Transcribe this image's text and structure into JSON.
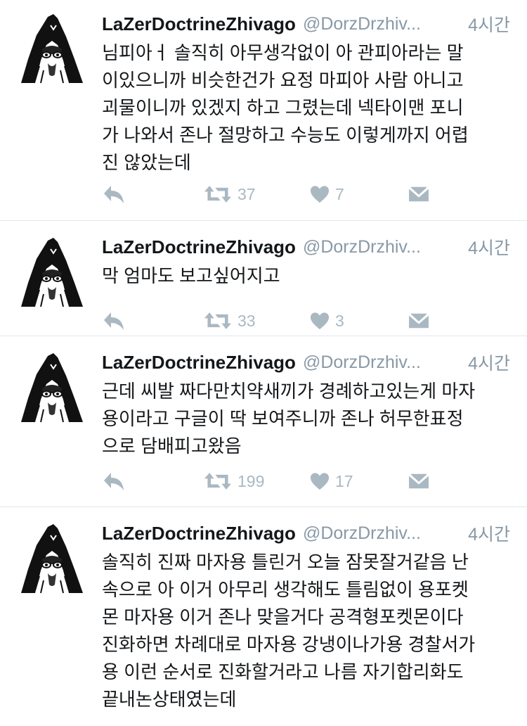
{
  "colors": {
    "text": "#14171a",
    "secondary": "#8899a6",
    "icon": "#aab8c2",
    "divider": "#e1e8ed"
  },
  "icons": {
    "reply": "reply-arrow-icon",
    "retweet": "retweet-icon",
    "like": "heart-icon",
    "dm": "envelope-icon"
  },
  "tweets": [
    {
      "name": "LaZerDoctrineZhivago",
      "handle": "@DorzDrzhiv...",
      "time": "4시간",
      "text": "님피아ㅓ  솔직히 아무생각없이 아 관피아라는 말\n이있으니까 비슷한건가 요정 마피아 사람 아니고\n괴물이니까 있겠지 하고 그렸는데 넥타이맨 포니\n가 나와서 존나 절망하고 수능도 이렇게까지 어렵\n진 않았는데",
      "retweets": "37",
      "likes": "7"
    },
    {
      "name": "LaZerDoctrineZhivago",
      "handle": "@DorzDrzhiv...",
      "time": "4시간",
      "text": "막 엄마도 보고싶어지고",
      "retweets": "33",
      "likes": "3"
    },
    {
      "name": "LaZerDoctrineZhivago",
      "handle": "@DorzDrzhiv...",
      "time": "4시간",
      "text": "근데 씨발 짜다만치약새끼가 경례하고있는게 마자\n용이라고 구글이 딱 보여주니까 존나 허무한표정\n으로 담배피고왔음",
      "retweets": "199",
      "likes": "17"
    },
    {
      "name": "LaZerDoctrineZhivago",
      "handle": "@DorzDrzhiv...",
      "time": "4시간",
      "text": "솔직히 진짜 마자용 틀린거 오늘 잠못잘거같음 난\n속으로 아 이거 아무리 생각해도 틀림없이 용포켓\n몬 마자용 이거 존나 맞을거다 공격형포켓몬이다\n진화하면 차례대로 마자용 강냉이나가용 경찰서가\n용 이런 순서로 진화할거라고 나름 자기합리화도\n끝내논상태였는데"
    }
  ]
}
